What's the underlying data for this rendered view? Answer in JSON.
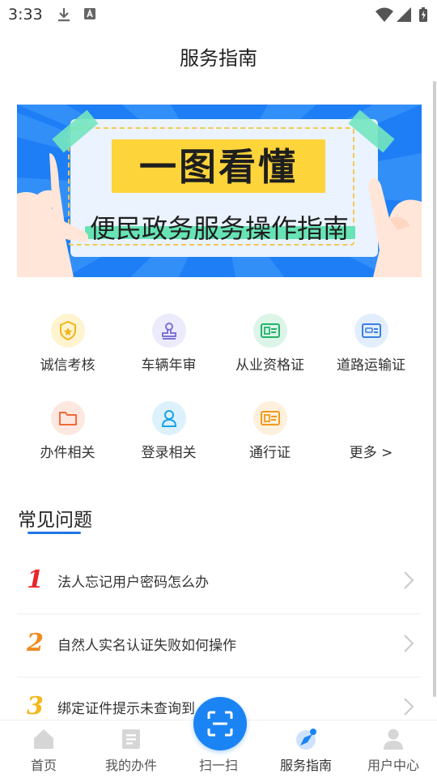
{
  "status_bar": {
    "time": "3:33"
  },
  "header": {
    "title": "服务指南"
  },
  "banner": {
    "title": "一图看懂",
    "subtitle": "便民政务服务操作指南"
  },
  "services": [
    {
      "label": "诚信考核",
      "icon": "credit-badge-icon",
      "color": "#f2b417"
    },
    {
      "label": "车辆年审",
      "icon": "stamp-icon",
      "color": "#7c72d9"
    },
    {
      "label": "从业资格证",
      "icon": "id-card-icon",
      "color": "#23b36a"
    },
    {
      "label": "道路运输证",
      "icon": "vehicle-license-icon",
      "color": "#3a7fe0"
    },
    {
      "label": "办件相关",
      "icon": "folder-icon",
      "color": "#f0693b"
    },
    {
      "label": "登录相关",
      "icon": "user-icon",
      "color": "#1aa2e6"
    },
    {
      "label": "通行证",
      "icon": "pass-card-icon",
      "color": "#f09a1c"
    },
    {
      "label": "更多 >",
      "icon": "",
      "color": ""
    }
  ],
  "faq": {
    "title": "常见问题",
    "items": [
      {
        "num": "1",
        "text": "法人忘记用户密码怎么办",
        "color": "#e8262a"
      },
      {
        "num": "2",
        "text": "自然人实名认证失败如何操作",
        "color": "#f08a1f"
      },
      {
        "num": "3",
        "text": "绑定证件提示未查询到...信息",
        "color": "#f4b81c"
      }
    ]
  },
  "bottom_nav": {
    "items": [
      {
        "label": "首页",
        "icon": "home-icon"
      },
      {
        "label": "我的办件",
        "icon": "my-files-icon"
      },
      {
        "label": "扫一扫",
        "icon": "scan-icon"
      },
      {
        "label": "服务指南",
        "icon": "compass-icon"
      },
      {
        "label": "用户中心",
        "icon": "user-center-icon"
      }
    ]
  },
  "colors": {
    "accent": "#1b84f4",
    "nav_inactive": "#d6d6d6"
  }
}
